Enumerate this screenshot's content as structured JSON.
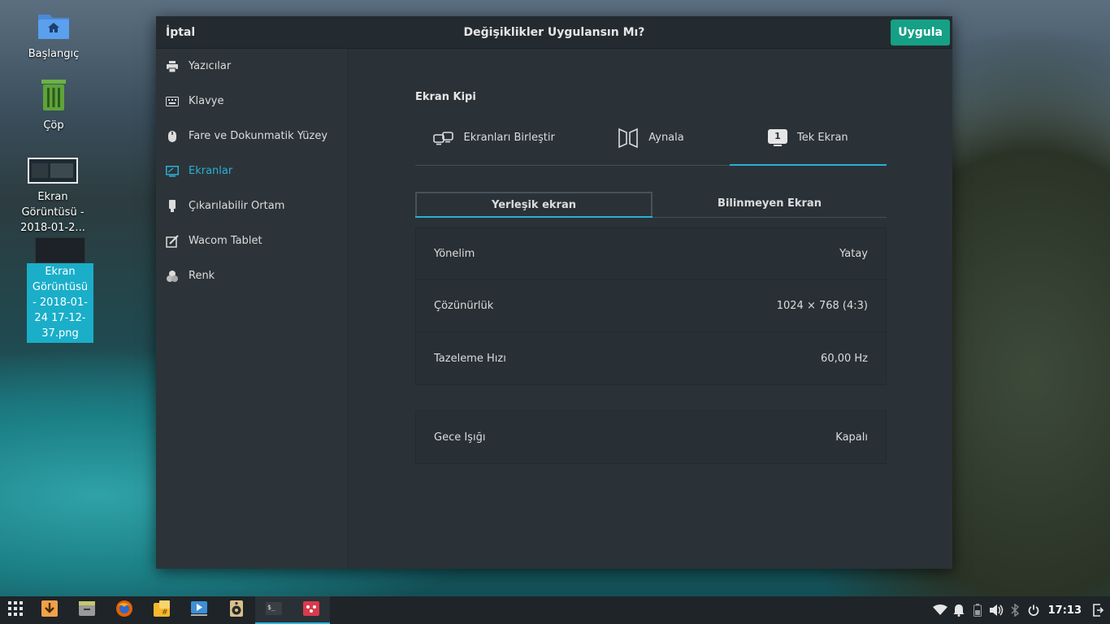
{
  "desktop": {
    "icons": [
      {
        "label": "Başlangıç"
      },
      {
        "label": "Çöp"
      },
      {
        "label": "Ekran Görüntüsü - 2018-01-2..."
      },
      {
        "label": "Ekran Görüntüsü - 2018-01-24 17-12-37.png"
      }
    ]
  },
  "dialog": {
    "cancel_label": "İptal",
    "title": "Değişiklikler Uygulansın Mı?",
    "apply_label": "Uygula",
    "apply_color": "#16a085"
  },
  "sidebar": {
    "items": [
      {
        "label": "Yazıcılar",
        "icon": "printer-icon"
      },
      {
        "label": "Klavye",
        "icon": "keyboard-icon"
      },
      {
        "label": "Fare ve Dokunmatik Yüzey",
        "icon": "mouse-icon"
      },
      {
        "label": "Ekranlar",
        "icon": "display-icon",
        "active": true
      },
      {
        "label": "Çıkarılabilir Ortam",
        "icon": "usb-drive-icon"
      },
      {
        "label": "Wacom Tablet",
        "icon": "tablet-icon"
      },
      {
        "label": "Renk",
        "icon": "color-icon"
      }
    ],
    "accent": "#2ab0d6"
  },
  "display": {
    "section_title": "Ekran Kipi",
    "modes": [
      {
        "label": "Ekranları Birleştir",
        "icon": "join-displays-icon"
      },
      {
        "label": "Aynala",
        "icon": "mirror-icon"
      },
      {
        "label": "Tek Ekran",
        "icon": "single-display-icon",
        "badge": "1",
        "active": true
      }
    ],
    "tabs": [
      {
        "label": "Yerleşik ekran",
        "active": true
      },
      {
        "label": "Bilinmeyen Ekran"
      }
    ],
    "settings": [
      {
        "label": "Yönelim",
        "value": "Yatay"
      },
      {
        "label": "Çözünürlük",
        "value": "1024 × 768 (4:3)"
      },
      {
        "label": "Tazeleme Hızı",
        "value": "60,00 Hz"
      }
    ],
    "night_light": {
      "label": "Gece Işığı",
      "value": "Kapalı"
    }
  },
  "taskbar": {
    "apps": [
      "launcher-icon",
      "download-icon",
      "file-manager-icon",
      "firefox-icon",
      "calculator-icon",
      "video-player-icon",
      "music-player-icon",
      "terminal-icon",
      "screenshot-icon"
    ],
    "clock": "17:13"
  }
}
